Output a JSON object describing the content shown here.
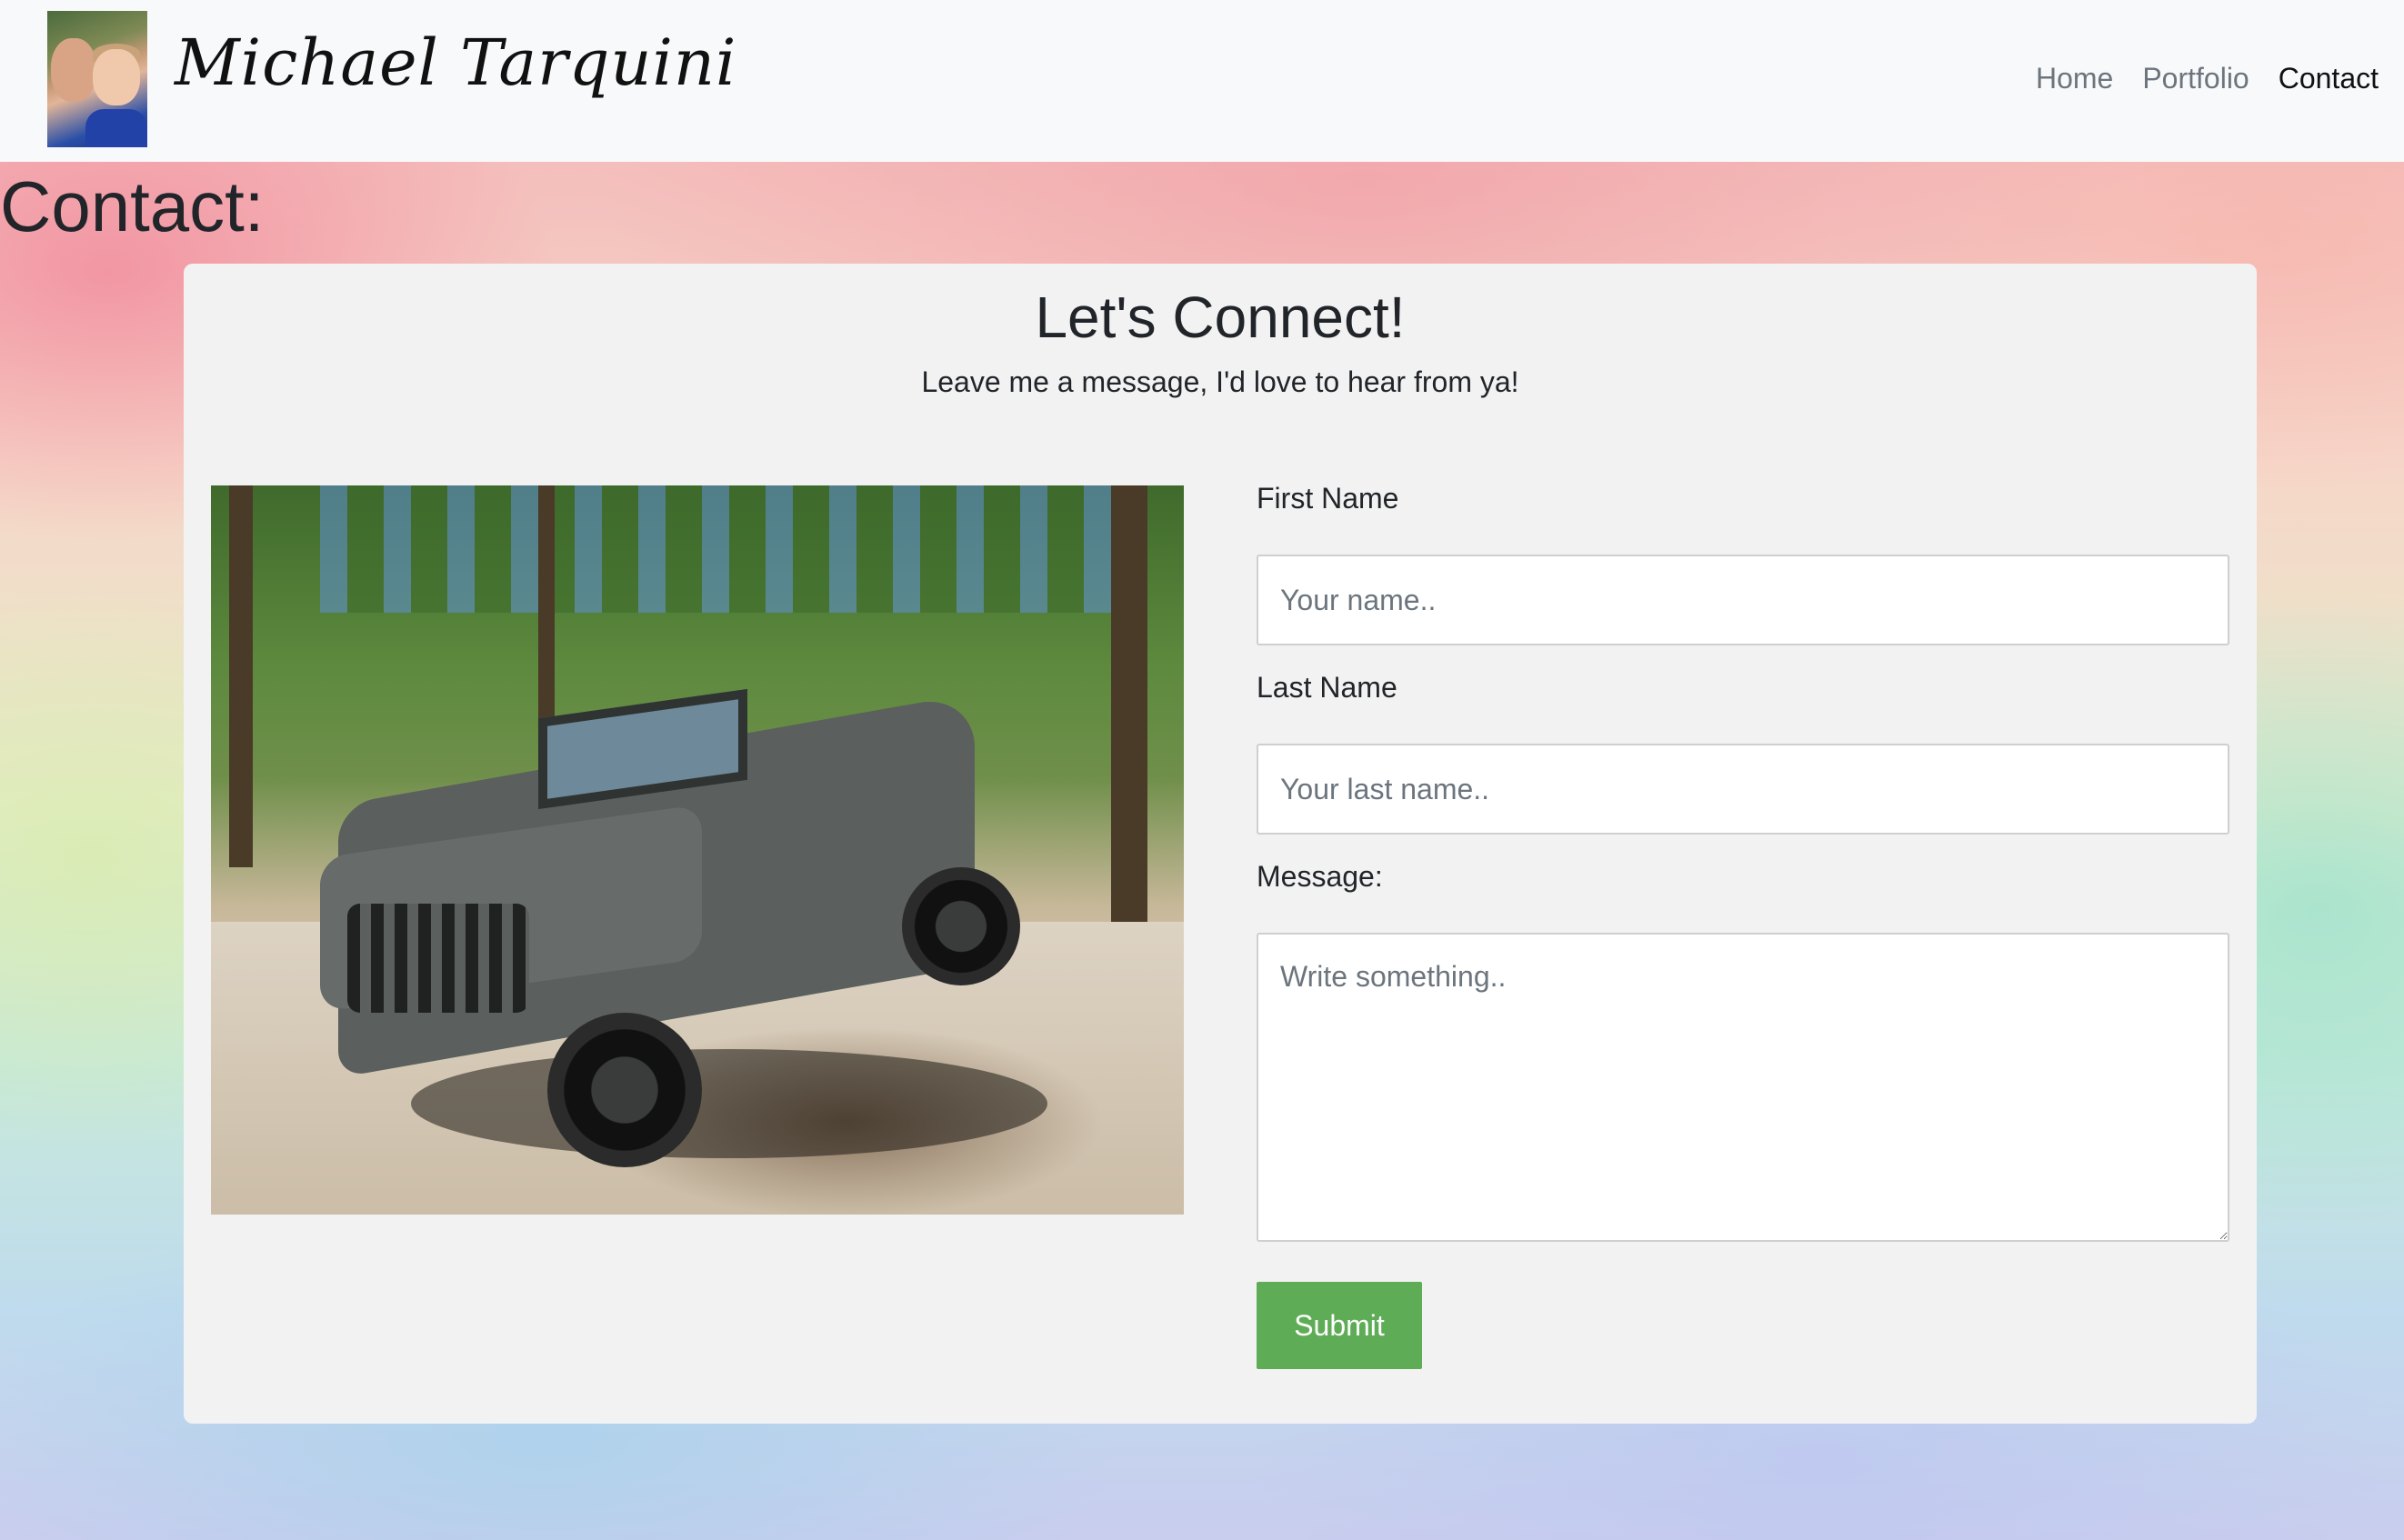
{
  "navbar": {
    "brand_name": "Michael Tarquini",
    "links": [
      {
        "label": "Home",
        "active": false
      },
      {
        "label": "Portfolio",
        "active": false
      },
      {
        "label": "Contact",
        "active": true
      }
    ]
  },
  "page_heading": "Contact:",
  "card": {
    "title": "Let's Connect!",
    "subtitle": "Leave me a message, I'd love to hear from ya!"
  },
  "form": {
    "first_name_label": "First Name",
    "first_name_placeholder": "Your name..",
    "last_name_label": "Last Name",
    "last_name_placeholder": "Your last name..",
    "message_label": "Message:",
    "message_placeholder": "Write something..",
    "submit_label": "Submit"
  },
  "colors": {
    "navbar_bg": "#f8f9fa",
    "card_bg": "#f2f2f2",
    "submit_bg": "#5fac56",
    "nav_inactive": "#6c757d",
    "nav_active": "#111111"
  }
}
